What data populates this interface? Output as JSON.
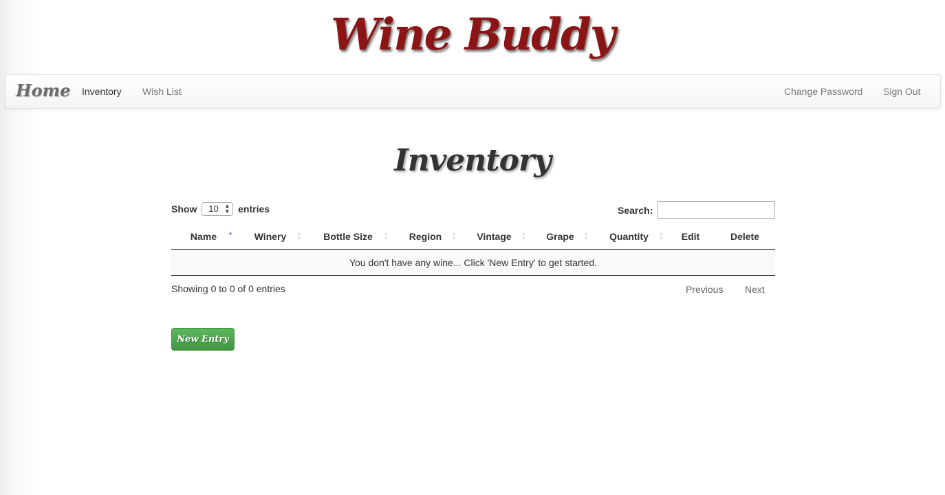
{
  "app": {
    "title": "Wine Buddy"
  },
  "navbar": {
    "home_label": "Home",
    "left_links": [
      {
        "label": "Inventory",
        "active": true
      },
      {
        "label": "Wish List",
        "active": false
      }
    ],
    "right_links": [
      {
        "label": "Change Password"
      },
      {
        "label": "Sign Out"
      }
    ]
  },
  "page": {
    "heading": "Inventory"
  },
  "table_controls": {
    "show_label": "Show",
    "entries_label": "entries",
    "page_length": "10",
    "search_label": "Search:",
    "search_value": ""
  },
  "table": {
    "columns": [
      {
        "label": "Name",
        "sort": "asc"
      },
      {
        "label": "Winery",
        "sort": "both"
      },
      {
        "label": "Bottle Size",
        "sort": "both"
      },
      {
        "label": "Region",
        "sort": "both"
      },
      {
        "label": "Vintage",
        "sort": "both"
      },
      {
        "label": "Grape",
        "sort": "both"
      },
      {
        "label": "Quantity",
        "sort": "both"
      },
      {
        "label": "Edit",
        "sort": "none"
      },
      {
        "label": "Delete",
        "sort": "none"
      }
    ],
    "rows": [],
    "empty_message": "You don't have any wine... Click 'New Entry' to get started."
  },
  "footer": {
    "info": "Showing 0 to 0 of 0 entries",
    "previous_label": "Previous",
    "next_label": "Next"
  },
  "actions": {
    "new_entry_label": "New Entry"
  },
  "colors": {
    "brand": "#8b1515",
    "button_green": "#4cae4c",
    "sort_active": "#7b83d6"
  }
}
